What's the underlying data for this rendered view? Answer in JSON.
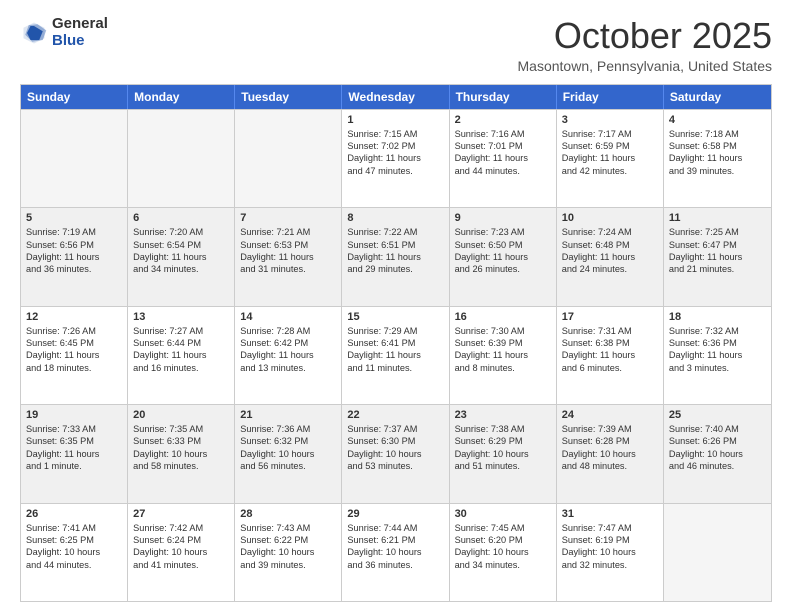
{
  "header": {
    "logo_general": "General",
    "logo_blue": "Blue",
    "month": "October 2025",
    "location": "Masontown, Pennsylvania, United States"
  },
  "days_of_week": [
    "Sunday",
    "Monday",
    "Tuesday",
    "Wednesday",
    "Thursday",
    "Friday",
    "Saturday"
  ],
  "rows": [
    [
      {
        "num": "",
        "text": "",
        "empty": true
      },
      {
        "num": "",
        "text": "",
        "empty": true
      },
      {
        "num": "",
        "text": "",
        "empty": true
      },
      {
        "num": "1",
        "text": "Sunrise: 7:15 AM\nSunset: 7:02 PM\nDaylight: 11 hours\nand 47 minutes.",
        "empty": false
      },
      {
        "num": "2",
        "text": "Sunrise: 7:16 AM\nSunset: 7:01 PM\nDaylight: 11 hours\nand 44 minutes.",
        "empty": false
      },
      {
        "num": "3",
        "text": "Sunrise: 7:17 AM\nSunset: 6:59 PM\nDaylight: 11 hours\nand 42 minutes.",
        "empty": false
      },
      {
        "num": "4",
        "text": "Sunrise: 7:18 AM\nSunset: 6:58 PM\nDaylight: 11 hours\nand 39 minutes.",
        "empty": false
      }
    ],
    [
      {
        "num": "5",
        "text": "Sunrise: 7:19 AM\nSunset: 6:56 PM\nDaylight: 11 hours\nand 36 minutes.",
        "shaded": true
      },
      {
        "num": "6",
        "text": "Sunrise: 7:20 AM\nSunset: 6:54 PM\nDaylight: 11 hours\nand 34 minutes.",
        "shaded": true
      },
      {
        "num": "7",
        "text": "Sunrise: 7:21 AM\nSunset: 6:53 PM\nDaylight: 11 hours\nand 31 minutes.",
        "shaded": true
      },
      {
        "num": "8",
        "text": "Sunrise: 7:22 AM\nSunset: 6:51 PM\nDaylight: 11 hours\nand 29 minutes.",
        "shaded": true
      },
      {
        "num": "9",
        "text": "Sunrise: 7:23 AM\nSunset: 6:50 PM\nDaylight: 11 hours\nand 26 minutes.",
        "shaded": true
      },
      {
        "num": "10",
        "text": "Sunrise: 7:24 AM\nSunset: 6:48 PM\nDaylight: 11 hours\nand 24 minutes.",
        "shaded": true
      },
      {
        "num": "11",
        "text": "Sunrise: 7:25 AM\nSunset: 6:47 PM\nDaylight: 11 hours\nand 21 minutes.",
        "shaded": true
      }
    ],
    [
      {
        "num": "12",
        "text": "Sunrise: 7:26 AM\nSunset: 6:45 PM\nDaylight: 11 hours\nand 18 minutes.",
        "empty": false
      },
      {
        "num": "13",
        "text": "Sunrise: 7:27 AM\nSunset: 6:44 PM\nDaylight: 11 hours\nand 16 minutes.",
        "empty": false
      },
      {
        "num": "14",
        "text": "Sunrise: 7:28 AM\nSunset: 6:42 PM\nDaylight: 11 hours\nand 13 minutes.",
        "empty": false
      },
      {
        "num": "15",
        "text": "Sunrise: 7:29 AM\nSunset: 6:41 PM\nDaylight: 11 hours\nand 11 minutes.",
        "empty": false
      },
      {
        "num": "16",
        "text": "Sunrise: 7:30 AM\nSunset: 6:39 PM\nDaylight: 11 hours\nand 8 minutes.",
        "empty": false
      },
      {
        "num": "17",
        "text": "Sunrise: 7:31 AM\nSunset: 6:38 PM\nDaylight: 11 hours\nand 6 minutes.",
        "empty": false
      },
      {
        "num": "18",
        "text": "Sunrise: 7:32 AM\nSunset: 6:36 PM\nDaylight: 11 hours\nand 3 minutes.",
        "empty": false
      }
    ],
    [
      {
        "num": "19",
        "text": "Sunrise: 7:33 AM\nSunset: 6:35 PM\nDaylight: 11 hours\nand 1 minute.",
        "shaded": true
      },
      {
        "num": "20",
        "text": "Sunrise: 7:35 AM\nSunset: 6:33 PM\nDaylight: 10 hours\nand 58 minutes.",
        "shaded": true
      },
      {
        "num": "21",
        "text": "Sunrise: 7:36 AM\nSunset: 6:32 PM\nDaylight: 10 hours\nand 56 minutes.",
        "shaded": true
      },
      {
        "num": "22",
        "text": "Sunrise: 7:37 AM\nSunset: 6:30 PM\nDaylight: 10 hours\nand 53 minutes.",
        "shaded": true
      },
      {
        "num": "23",
        "text": "Sunrise: 7:38 AM\nSunset: 6:29 PM\nDaylight: 10 hours\nand 51 minutes.",
        "shaded": true
      },
      {
        "num": "24",
        "text": "Sunrise: 7:39 AM\nSunset: 6:28 PM\nDaylight: 10 hours\nand 48 minutes.",
        "shaded": true
      },
      {
        "num": "25",
        "text": "Sunrise: 7:40 AM\nSunset: 6:26 PM\nDaylight: 10 hours\nand 46 minutes.",
        "shaded": true
      }
    ],
    [
      {
        "num": "26",
        "text": "Sunrise: 7:41 AM\nSunset: 6:25 PM\nDaylight: 10 hours\nand 44 minutes.",
        "empty": false
      },
      {
        "num": "27",
        "text": "Sunrise: 7:42 AM\nSunset: 6:24 PM\nDaylight: 10 hours\nand 41 minutes.",
        "empty": false
      },
      {
        "num": "28",
        "text": "Sunrise: 7:43 AM\nSunset: 6:22 PM\nDaylight: 10 hours\nand 39 minutes.",
        "empty": false
      },
      {
        "num": "29",
        "text": "Sunrise: 7:44 AM\nSunset: 6:21 PM\nDaylight: 10 hours\nand 36 minutes.",
        "empty": false
      },
      {
        "num": "30",
        "text": "Sunrise: 7:45 AM\nSunset: 6:20 PM\nDaylight: 10 hours\nand 34 minutes.",
        "empty": false
      },
      {
        "num": "31",
        "text": "Sunrise: 7:47 AM\nSunset: 6:19 PM\nDaylight: 10 hours\nand 32 minutes.",
        "empty": false
      },
      {
        "num": "",
        "text": "",
        "empty": true
      }
    ]
  ]
}
